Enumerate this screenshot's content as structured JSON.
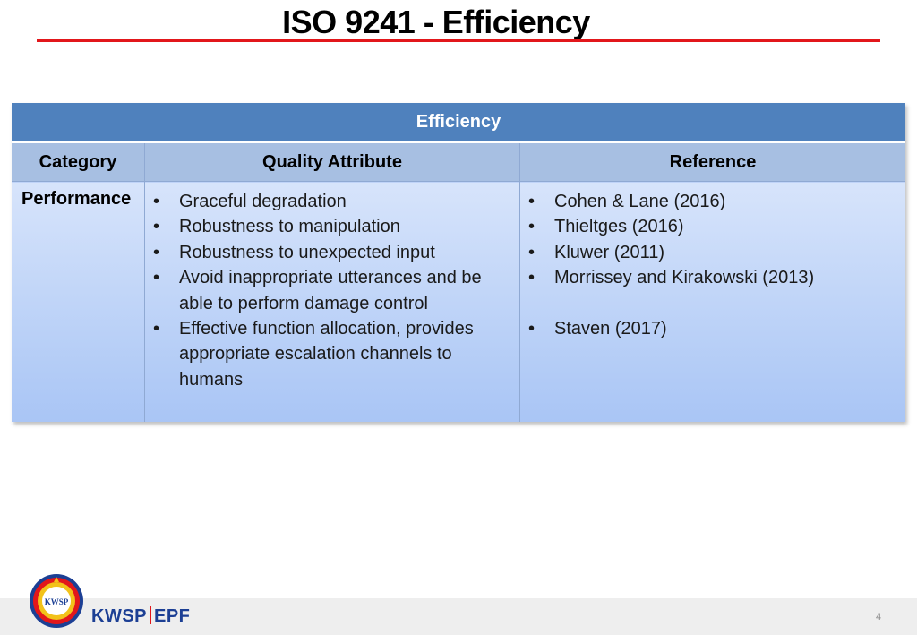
{
  "slide": {
    "title": "ISO 9241 - Efficiency",
    "page_number": "4"
  },
  "table": {
    "banner": "Efficiency",
    "headers": [
      "Category",
      "Quality Attribute",
      "Reference"
    ],
    "row": {
      "category": "Performance",
      "attributes": [
        "Graceful degradation",
        "Robustness to manipulation",
        "Robustness to unexpected input",
        "Avoid inappropriate utterances and be able to perform damage control",
        "Effective function allocation, provides appropriate escalation channels to humans"
      ],
      "references": [
        "Cohen & Lane (2016)",
        "Thieltges (2016)",
        "Kluwer (2011)",
        "Morrissey and Kirakowski (2013)",
        "Staven (2017)"
      ]
    }
  },
  "footer": {
    "brand_left": "KWSP",
    "brand_right": "EPF",
    "logo_monogram": "KWSP",
    "brand_color": "#1c3f94",
    "accent_color": "#e2171b"
  }
}
